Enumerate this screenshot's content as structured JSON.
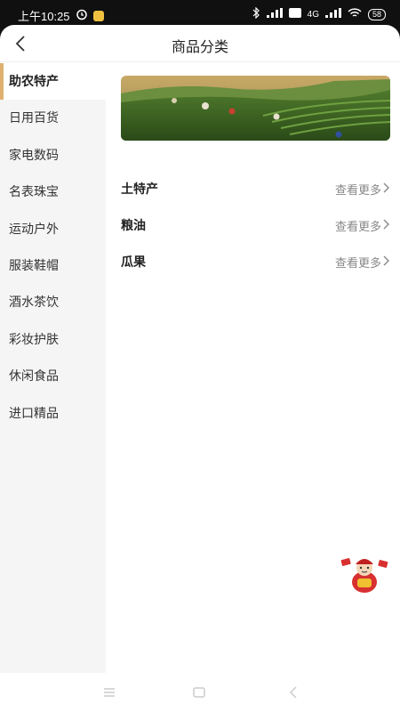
{
  "status_bar": {
    "time": "上午10:25",
    "network": "4G",
    "battery": "58"
  },
  "header": {
    "title": "商品分类"
  },
  "sidebar": {
    "items": [
      {
        "label": "助农特产",
        "active": true
      },
      {
        "label": "日用百货"
      },
      {
        "label": "家电数码"
      },
      {
        "label": "名表珠宝"
      },
      {
        "label": "运动户外"
      },
      {
        "label": "服装鞋帽"
      },
      {
        "label": "酒水茶饮"
      },
      {
        "label": "彩妆护肤"
      },
      {
        "label": "休闲食品"
      },
      {
        "label": "进口精品"
      }
    ]
  },
  "content": {
    "banner": {
      "icon": "tea-plantation-image"
    },
    "categories": [
      {
        "name": "土特产",
        "more_label": "查看更多"
      },
      {
        "name": "粮油",
        "more_label": "查看更多"
      },
      {
        "name": "瓜果",
        "more_label": "查看更多"
      }
    ]
  },
  "colors": {
    "accent": "#e0b070",
    "sidebar_bg": "#f5f5f5",
    "status_bar_bg": "#101010"
  }
}
